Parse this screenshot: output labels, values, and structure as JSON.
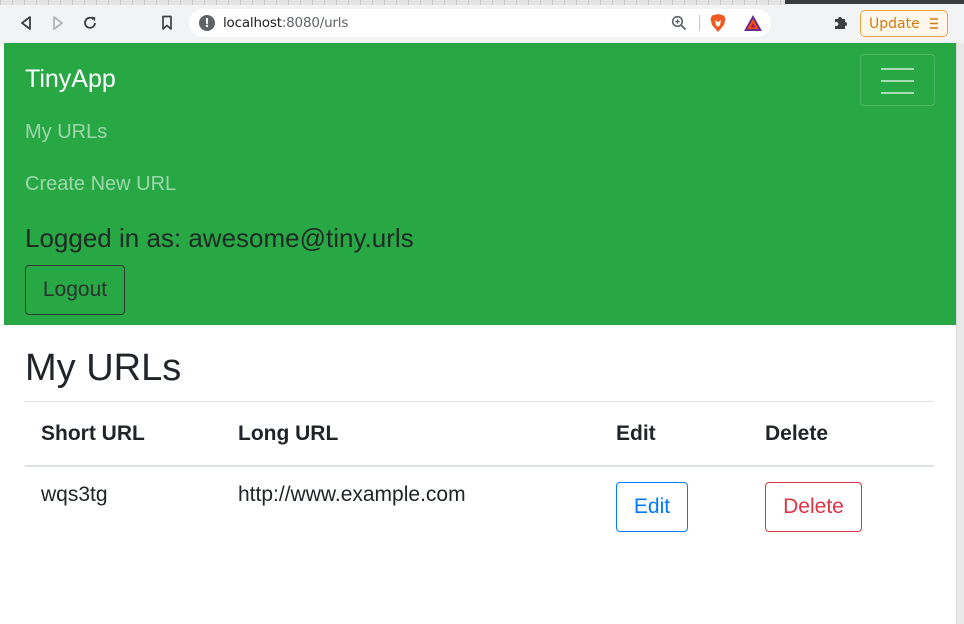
{
  "browser": {
    "url_host": "localhost",
    "url_rest": ":8080/urls",
    "update_label": "Update"
  },
  "navbar": {
    "brand": "TinyApp",
    "links": [
      "My URLs",
      "Create New URL"
    ],
    "logged_in_text": "Logged in as: awesome@tiny.urls",
    "logout_label": "Logout",
    "background_color": "#28a745"
  },
  "main": {
    "title": "My URLs",
    "table": {
      "headers": [
        "Short URL",
        "Long URL",
        "Edit",
        "Delete"
      ],
      "rows": [
        {
          "short_url": "wqs3tg",
          "long_url": "http://www.example.com",
          "edit_label": "Edit",
          "delete_label": "Delete"
        }
      ]
    }
  },
  "colors": {
    "edit": "#007bff",
    "delete": "#dc3545"
  },
  "icons": [
    "back-icon",
    "forward-icon",
    "reload-icon",
    "bookmark-icon",
    "info-icon",
    "zoom-icon",
    "brave-shield-icon",
    "bat-rewards-icon",
    "extensions-icon",
    "menu-icon",
    "hamburger-icon"
  ]
}
